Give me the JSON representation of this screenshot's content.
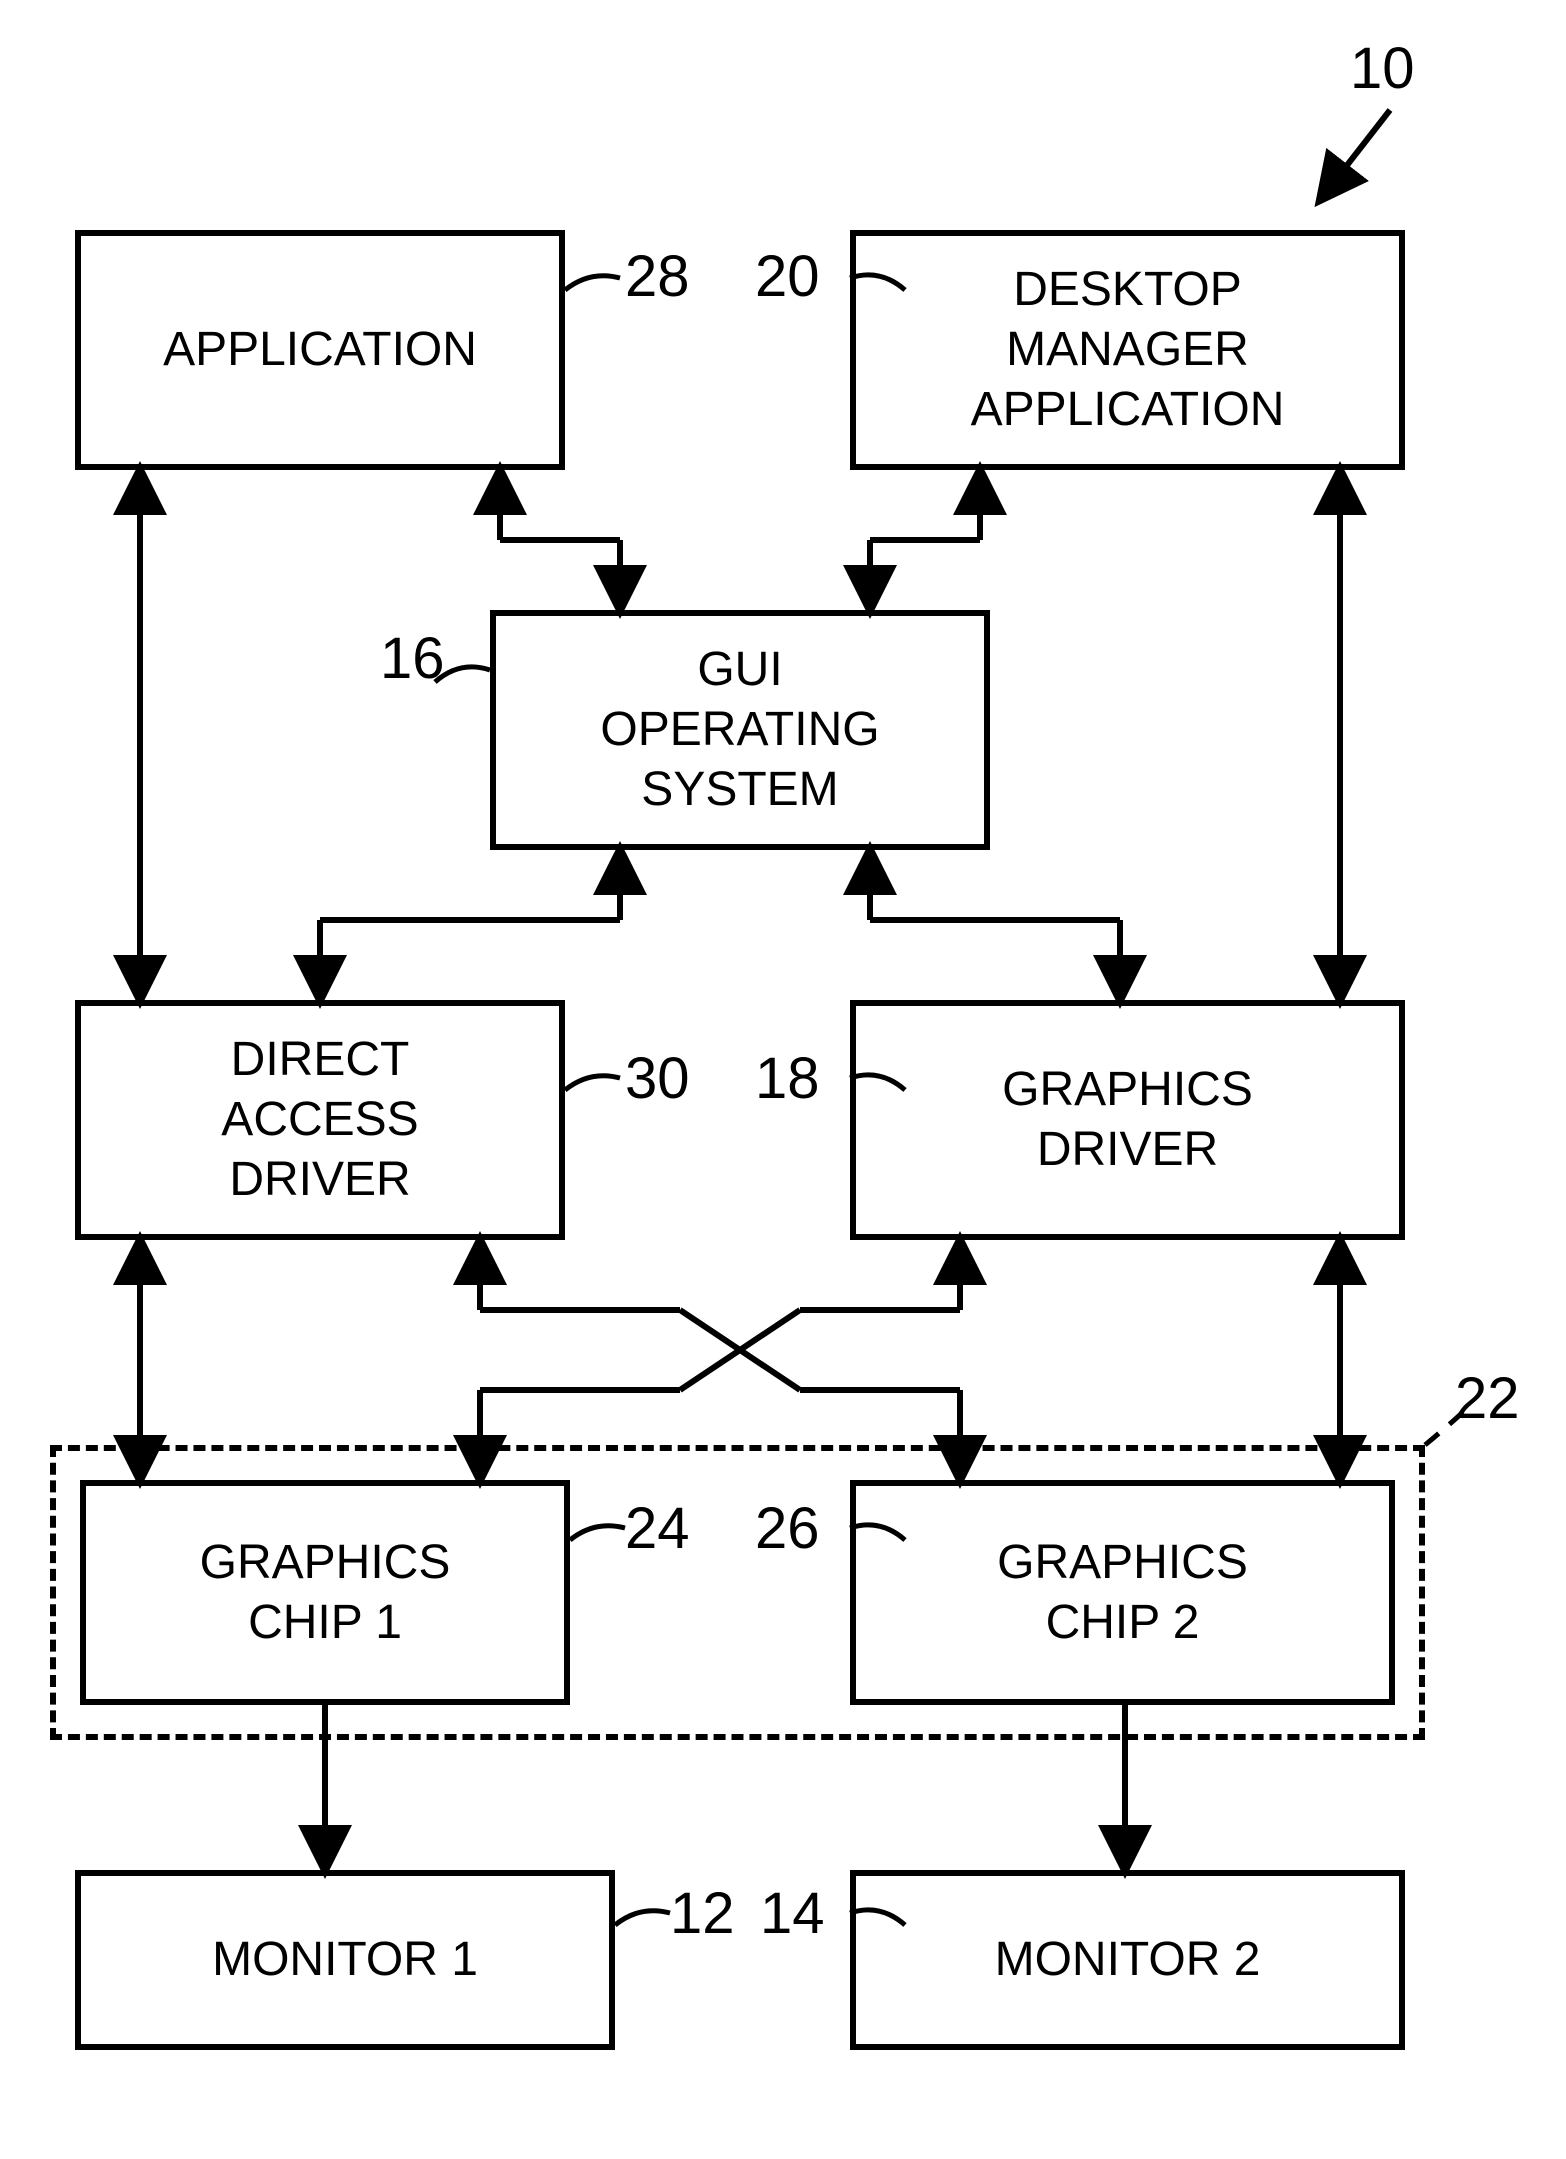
{
  "figure_ref": "10",
  "blocks": {
    "application": {
      "label": "APPLICATION",
      "ref": "28"
    },
    "desktop_manager": {
      "label": "DESKTOP\nMANAGER\nAPPLICATION",
      "ref": "20"
    },
    "gui_os": {
      "label": "GUI\nOPERATING\nSYSTEM",
      "ref": "16"
    },
    "direct_access": {
      "label": "DIRECT\nACCESS\nDRIVER",
      "ref": "30"
    },
    "graphics_driver": {
      "label": "GRAPHICS\nDRIVER",
      "ref": "18"
    },
    "graphics_chip_1": {
      "label": "GRAPHICS\nCHIP 1",
      "ref": "24"
    },
    "graphics_chip_2": {
      "label": "GRAPHICS\nCHIP 2",
      "ref": "26"
    },
    "monitor_1": {
      "label": "MONITOR 1",
      "ref": "12"
    },
    "monitor_2": {
      "label": "MONITOR 2",
      "ref": "14"
    },
    "gpu_group": {
      "ref": "22"
    }
  },
  "diagram": {
    "type": "block-diagram",
    "nodes": [
      {
        "id": "application",
        "ref": "28"
      },
      {
        "id": "desktop_manager",
        "ref": "20"
      },
      {
        "id": "gui_os",
        "ref": "16"
      },
      {
        "id": "direct_access",
        "ref": "30"
      },
      {
        "id": "graphics_driver",
        "ref": "18"
      },
      {
        "id": "graphics_chip_1",
        "ref": "24"
      },
      {
        "id": "graphics_chip_2",
        "ref": "26"
      },
      {
        "id": "monitor_1",
        "ref": "12"
      },
      {
        "id": "monitor_2",
        "ref": "14"
      }
    ],
    "groups": [
      {
        "id": "gpu_group",
        "ref": "22",
        "contains": [
          "graphics_chip_1",
          "graphics_chip_2"
        ]
      }
    ],
    "edges": [
      {
        "from": "application",
        "to": "gui_os",
        "bidir": true
      },
      {
        "from": "application",
        "to": "direct_access",
        "bidir": true
      },
      {
        "from": "desktop_manager",
        "to": "gui_os",
        "bidir": true
      },
      {
        "from": "desktop_manager",
        "to": "graphics_driver",
        "bidir": true
      },
      {
        "from": "gui_os",
        "to": "direct_access",
        "bidir": true
      },
      {
        "from": "gui_os",
        "to": "graphics_driver",
        "bidir": true
      },
      {
        "from": "direct_access",
        "to": "graphics_chip_1",
        "bidir": true
      },
      {
        "from": "direct_access",
        "to": "graphics_chip_2",
        "bidir": true
      },
      {
        "from": "graphics_driver",
        "to": "graphics_chip_1",
        "bidir": true
      },
      {
        "from": "graphics_driver",
        "to": "graphics_chip_2",
        "bidir": true
      },
      {
        "from": "graphics_chip_1",
        "to": "monitor_1",
        "bidir": false
      },
      {
        "from": "graphics_chip_2",
        "to": "monitor_2",
        "bidir": false
      }
    ]
  }
}
